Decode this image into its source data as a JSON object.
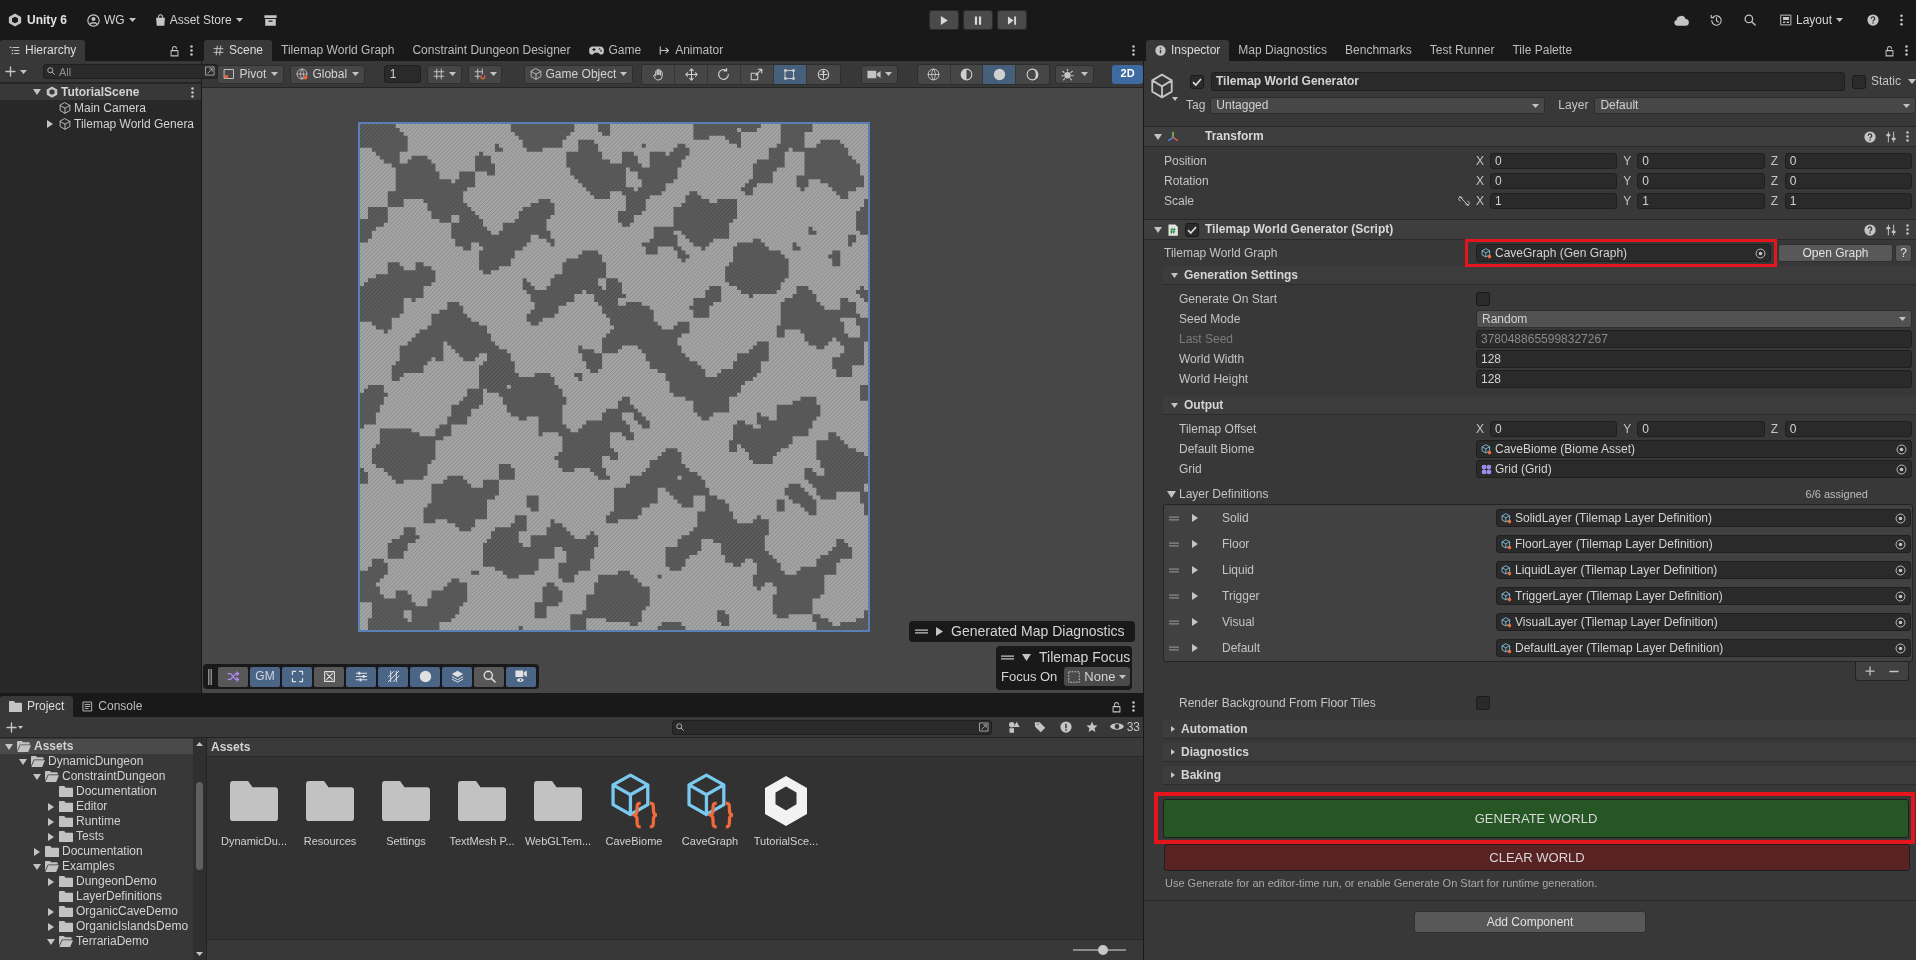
{
  "top_bar": {
    "title": "Unity 6",
    "account": "WG",
    "store": "Asset Store",
    "layout": "Layout"
  },
  "hierarchy": {
    "tabs": [
      {
        "label": "Hierarchy",
        "selected": true
      }
    ],
    "search": {
      "placeholder": "All"
    },
    "tree": [
      {
        "name": "TutorialScene",
        "kind": "scene",
        "expanded": true,
        "children": [
          {
            "name": "Main Camera",
            "kind": "object"
          },
          {
            "name": "Tilemap World Genera",
            "kind": "object",
            "expanded": false
          }
        ]
      }
    ]
  },
  "scene": {
    "tabs": [
      {
        "label": "Scene",
        "kind": "scene",
        "selected": true
      },
      {
        "label": "Tilemap World Graph",
        "kind": "plain",
        "selected": false
      },
      {
        "label": "Constraint Dungeon Designer",
        "kind": "plain",
        "selected": false
      },
      {
        "label": "Game",
        "kind": "game",
        "selected": false
      },
      {
        "label": "Animator",
        "kind": "animator",
        "selected": false
      }
    ],
    "toolbar": {
      "pivot": "Pivot",
      "space": "Global",
      "snap": "1",
      "create": "Game Object",
      "tools": [
        {
          "kind": "hand",
          "selected": false
        },
        {
          "kind": "move",
          "selected": false
        },
        {
          "kind": "rotate",
          "selected": false
        },
        {
          "kind": "scale",
          "selected": false
        },
        {
          "kind": "rect",
          "selected": true
        },
        {
          "kind": "transform",
          "selected": false
        }
      ],
      "shading": [
        {
          "kind": "wireframe",
          "selected": false
        },
        {
          "kind": "shaded",
          "selected": false
        },
        {
          "kind": "lit",
          "selected": true
        },
        {
          "kind": "unlit",
          "selected": false
        }
      ],
      "mode_2d": {
        "label": "2D",
        "selected": true
      }
    },
    "overlays": {
      "diagnostics": {
        "title": "Generated Map Diagnostics",
        "expanded": false
      },
      "focus": {
        "title": "Tilemap Focus",
        "expanded": true,
        "label": "Focus On",
        "value": "None"
      },
      "tools": [
        {
          "kind": "shuffle",
          "selected": false
        },
        {
          "kind": "text",
          "label": "GM",
          "selected": true
        },
        {
          "kind": "frame",
          "selected": true
        },
        {
          "kind": "cross",
          "selected": false
        },
        {
          "kind": "sliders",
          "selected": true
        },
        {
          "kind": "grid",
          "selected": true
        },
        {
          "kind": "dot",
          "selected": true
        },
        {
          "kind": "layers",
          "selected": true
        },
        {
          "kind": "search",
          "selected": false
        },
        {
          "kind": "camera",
          "selected": true
        }
      ]
    }
  },
  "project": {
    "tabs": [
      {
        "label": "Project",
        "kind": "project",
        "selected": true
      },
      {
        "label": "Console",
        "kind": "console",
        "selected": false
      }
    ],
    "hidden_count": "33",
    "tree": [
      {
        "name": "Assets",
        "expanded": true,
        "selected": true,
        "children": [
          {
            "name": "DynamicDungeon",
            "expanded": true,
            "selected": false,
            "children": [
              {
                "name": "ConstraintDungeon",
                "expanded": true,
                "selected": false,
                "children": [
                  {
                    "name": "Documentation",
                    "selected": false
                  },
                  {
                    "name": "Editor",
                    "expanded": false,
                    "selected": false
                  },
                  {
                    "name": "Runtime",
                    "expanded": false,
                    "selected": false
                  },
                  {
                    "name": "Tests",
                    "expanded": false,
                    "selected": false
                  }
                ]
              },
              {
                "name": "Documentation",
                "expanded": false,
                "selected": false
              },
              {
                "name": "Examples",
                "expanded": true,
                "selected": false,
                "children": [
                  {
                    "name": "DungeonDemo",
                    "expanded": false,
                    "selected": false
                  },
                  {
                    "name": "LayerDefinitions",
                    "selected": false
                  },
                  {
                    "name": "OrganicCaveDemo",
                    "expanded": false,
                    "selected": false
                  },
                  {
                    "name": "OrganicIslandsDemo",
                    "expanded": false,
                    "selected": false
                  },
                  {
                    "name": "TerrariaDemo",
                    "expanded": true,
                    "selected": false
                  }
                ]
              }
            ]
          }
        ]
      }
    ],
    "breadcrumb": "Assets",
    "items": [
      {
        "name": "DynamicDu...",
        "kind": "folder"
      },
      {
        "name": "Resources",
        "kind": "folder"
      },
      {
        "name": "Settings",
        "kind": "folder"
      },
      {
        "name": "TextMesh P...",
        "kind": "folder"
      },
      {
        "name": "WebGLTem...",
        "kind": "folder"
      },
      {
        "name": "CaveBiome",
        "kind": "script_asset"
      },
      {
        "name": "CaveGraph",
        "kind": "script_asset"
      },
      {
        "name": "TutorialSce...",
        "kind": "scene"
      }
    ],
    "zoom_slider": {
      "level": 0.57
    }
  },
  "inspector": {
    "tabs": [
      {
        "label": "Inspector",
        "kind": "info",
        "selected": true
      },
      {
        "label": "Map Diagnostics",
        "kind": "plain",
        "selected": false
      },
      {
        "label": "Benchmarks",
        "kind": "plain",
        "selected": false
      },
      {
        "label": "Test Runner",
        "kind": "plain",
        "selected": false
      },
      {
        "label": "Tile Palette",
        "kind": "plain",
        "selected": false
      }
    ],
    "object": {
      "active": true,
      "name": "Tilemap World Generator",
      "static": false,
      "static_label": "Static",
      "tag_label": "Tag",
      "tag": "Untagged",
      "layer_label": "Layer",
      "layer": "Default"
    },
    "transform": {
      "title": "Transform",
      "expanded": true,
      "fields": [
        {
          "kind": "vector",
          "label": "Position",
          "axes": [
            {
              "axis": "X",
              "value": "0"
            },
            {
              "axis": "Y",
              "value": "0"
            },
            {
              "axis": "Z",
              "value": "0"
            }
          ]
        },
        {
          "kind": "vector",
          "label": "Rotation",
          "axes": [
            {
              "axis": "X",
              "value": "0"
            },
            {
              "axis": "Y",
              "value": "0"
            },
            {
              "axis": "Z",
              "value": "0"
            }
          ]
        },
        {
          "kind": "scale_vector",
          "label": "Scale",
          "axes": [
            {
              "axis": "X",
              "value": "1"
            },
            {
              "axis": "Y",
              "value": "1"
            },
            {
              "axis": "Z",
              "value": "1"
            }
          ]
        }
      ]
    },
    "script": {
      "title": "Tilemap World Generator (Script)",
      "enabled": true,
      "expanded": true,
      "fields": [
        {
          "kind": "object",
          "label": "Tilemap World Graph",
          "value": "CaveGraph (Gen Graph)",
          "highlighted": true,
          "button": "Open Graph",
          "help": "?"
        },
        {
          "kind": "section",
          "label": "Generation Settings",
          "expanded": true,
          "fields": [
            {
              "kind": "checkbox",
              "label": "Generate On Start",
              "checked": false
            },
            {
              "kind": "dropdown",
              "label": "Seed Mode",
              "value": "Random"
            },
            {
              "kind": "text",
              "label": "Last Seed",
              "value": "3780488655998327267",
              "disabled": true
            },
            {
              "kind": "text",
              "label": "World Width",
              "value": "128",
              "disabled": false
            },
            {
              "kind": "text",
              "label": "World Height",
              "value": "128",
              "disabled": false
            }
          ]
        },
        {
          "kind": "section",
          "label": "Output",
          "expanded": true,
          "fields": [
            {
              "kind": "vector",
              "label": "Tilemap Offset",
              "axes": [
                {
                  "axis": "X",
                  "value": "0"
                },
                {
                  "axis": "Y",
                  "value": "0"
                },
                {
                  "axis": "Z",
                  "value": "0"
                }
              ]
            },
            {
              "kind": "object",
              "label": "Default Biome",
              "value": "CaveBiome (Biome Asset)",
              "highlighted": false
            },
            {
              "kind": "grid_object",
              "label": "Grid",
              "value": "Grid (Grid)",
              "highlighted": false
            },
            {
              "kind": "list",
              "label": "Layer Definitions",
              "expanded": true,
              "count": "6/6 assigned",
              "items": [
                {
                  "name": "Solid",
                  "value": "SolidLayer (Tilemap Layer Definition)",
                  "expanded": false
                },
                {
                  "name": "Floor",
                  "value": "FloorLayer (Tilemap Layer Definition)",
                  "expanded": false
                },
                {
                  "name": "Liquid",
                  "value": "LiquidLayer (Tilemap Layer Definition)",
                  "expanded": false
                },
                {
                  "name": "Trigger",
                  "value": "TriggerLayer (Tilemap Layer Definition)",
                  "expanded": false
                },
                {
                  "name": "Visual",
                  "value": "VisualLayer (Tilemap Layer Definition)",
                  "expanded": false
                },
                {
                  "name": "Default",
                  "value": "DefaultLayer (Tilemap Layer Definition)",
                  "expanded": false
                }
              ]
            },
            {
              "kind": "checkbox",
              "label": "Render Background From Floor Tiles",
              "checked": false
            }
          ]
        },
        {
          "kind": "section",
          "label": "Automation",
          "expanded": false
        },
        {
          "kind": "section",
          "label": "Diagnostics",
          "expanded": false
        },
        {
          "kind": "section",
          "label": "Baking",
          "expanded": false
        }
      ]
    },
    "actions": [
      {
        "label": "GENERATE WORLD",
        "kind": "primary",
        "color": "#255624",
        "highlighted": true
      },
      {
        "label": "CLEAR WORLD",
        "kind": "secondary",
        "color": "#5a2323",
        "highlighted": false
      }
    ],
    "hint": "Use Generate for an editor-time run, or enable Generate On Start for runtime generation.",
    "add_component": "Add Component"
  }
}
